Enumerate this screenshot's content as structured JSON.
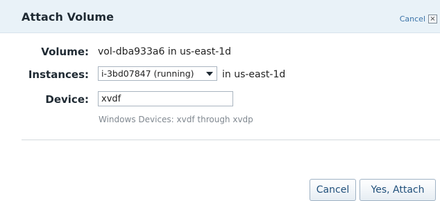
{
  "dialog": {
    "title": "Attach Volume",
    "header_cancel_label": "Cancel",
    "close_glyph": "×"
  },
  "form": {
    "volume_label": "Volume:",
    "volume_value": "vol-dba933a6 in us-east-1d",
    "instances_label": "Instances:",
    "instances_selected": "i-3bd07847 (running)",
    "instances_suffix": "in us-east-1d",
    "device_label": "Device:",
    "device_value": "xvdf",
    "device_hint": "Windows Devices: xvdf through xvdp"
  },
  "buttons": {
    "cancel_label": "Cancel",
    "attach_label": "Yes, Attach"
  },
  "icons": {
    "dropdown": "chevron-down-icon",
    "close": "close-icon"
  },
  "colors": {
    "header_bg": "#e9f2f8",
    "link": "#3b73a8",
    "button_text": "#1f4f7a",
    "hint_text": "#808890"
  }
}
